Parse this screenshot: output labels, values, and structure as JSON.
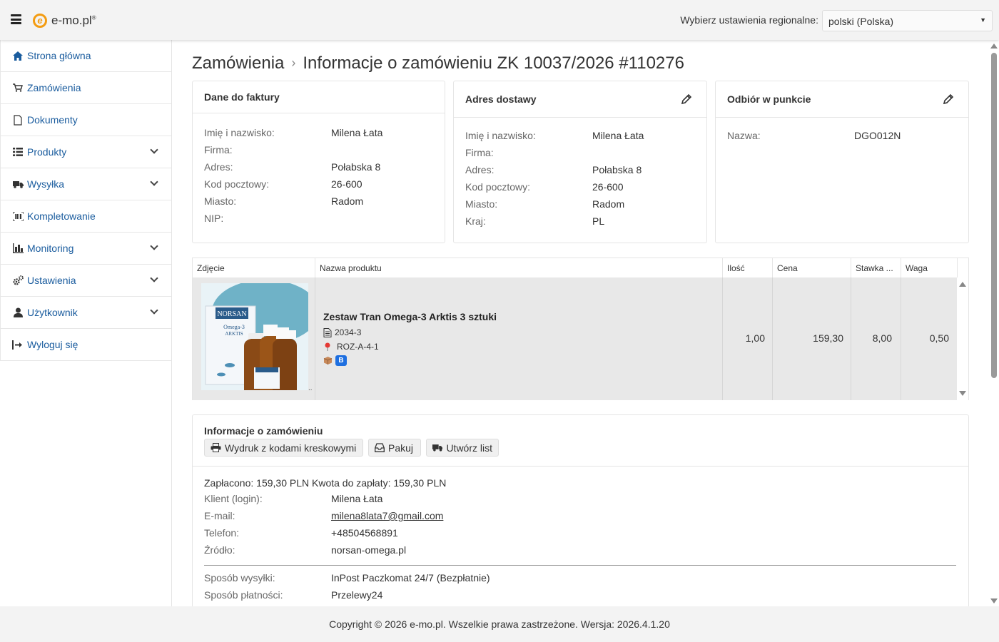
{
  "app": {
    "logo_text": "e-mo.pl",
    "logo_mark": "®"
  },
  "header": {
    "region_label": "Wybierz ustawienia regionalne:",
    "region_value": "polski (Polska)"
  },
  "sidebar": {
    "items": [
      {
        "label": "Strona główna",
        "icon": "home-icon"
      },
      {
        "label": "Zamówienia",
        "icon": "cart-icon"
      },
      {
        "label": "Dokumenty",
        "icon": "document-icon"
      },
      {
        "label": "Produkty",
        "icon": "list-icon",
        "expandable": true
      },
      {
        "label": "Wysyłka",
        "icon": "truck-icon",
        "expandable": true
      },
      {
        "label": "Kompletowanie",
        "icon": "barcode-icon"
      },
      {
        "label": "Monitoring",
        "icon": "chart-icon",
        "expandable": true
      },
      {
        "label": "Ustawienia",
        "icon": "gears-icon",
        "expandable": true
      },
      {
        "label": "Użytkownik",
        "icon": "user-icon",
        "expandable": true
      },
      {
        "label": "Wyloguj się",
        "icon": "logout-icon"
      }
    ]
  },
  "breadcrumb": {
    "root": "Zamówienia",
    "separator": "›",
    "current": "Informacje o zamówieniu ZK 10037/2026 #110276"
  },
  "invoice": {
    "title": "Dane do faktury",
    "fields": [
      {
        "label": "Imię i nazwisko:",
        "value": "Milena Łata"
      },
      {
        "label": "Firma:",
        "value": ""
      },
      {
        "label": "Adres:",
        "value": "Połabska 8"
      },
      {
        "label": "Kod pocztowy:",
        "value": "26-600"
      },
      {
        "label": "Miasto:",
        "value": "Radom"
      },
      {
        "label": "NIP:",
        "value": ""
      }
    ]
  },
  "delivery": {
    "title": "Adres dostawy",
    "fields": [
      {
        "label": "Imię i nazwisko:",
        "value": "Milena Łata"
      },
      {
        "label": "Firma:",
        "value": ""
      },
      {
        "label": "Adres:",
        "value": "Połabska 8"
      },
      {
        "label": "Kod pocztowy:",
        "value": "26-600"
      },
      {
        "label": "Miasto:",
        "value": "Radom"
      },
      {
        "label": "Kraj:",
        "value": "PL"
      }
    ]
  },
  "pickup": {
    "title": "Odbiór w punkcie",
    "fields": [
      {
        "label": "Nazwa:",
        "value": "DGO012N"
      }
    ]
  },
  "products": {
    "columns": [
      "Zdjęcie",
      "Nazwa produktu",
      "Ilość",
      "Cena",
      "Stawka ...",
      "Waga"
    ],
    "rows": [
      {
        "name": "Zestaw Tran Omega-3 Arktis 3 sztuki",
        "sku": "2034-3",
        "location": "ROZ-A-4-1",
        "badge": "B",
        "image_brand": "NORSAN",
        "image_line1": "Omega-3",
        "image_line2": "ARKTIS",
        "qty": "1,00",
        "price": "159,30",
        "vat": "8,00",
        "weight": "0,50"
      }
    ]
  },
  "order_info": {
    "title": "Informacje o zamówieniu",
    "buttons": {
      "print": "Wydruk z kodami kreskowymi",
      "pack": "Pakuj",
      "label": "Utwórz list"
    },
    "paid_line": "Zapłacono: 159,30 PLN Kwota do zapłaty: 159,30 PLN",
    "fields": [
      {
        "label": "Klient (login):",
        "value": "Milena Łata"
      },
      {
        "label": "E-mail:",
        "value": "milena8lata7@gmail.com"
      },
      {
        "label": "Telefon:",
        "value": "+48504568891"
      },
      {
        "label": "Źródło:",
        "value": "norsan-omega.pl"
      }
    ],
    "fields2": [
      {
        "label": "Sposób wysyłki:",
        "value": "InPost Paczkomat 24/7 (Bezpłatnie)"
      },
      {
        "label": "Sposób płatności:",
        "value": "Przelewy24"
      }
    ]
  },
  "footer": {
    "text": "Copyright © 2026 e-mo.pl. Wszelkie prawa zastrzeżone. Wersja: 2026.4.1.20"
  },
  "colors": {
    "link": "#1a5c9e",
    "logo": "#f39c12",
    "badge": "#1e6fe0"
  }
}
